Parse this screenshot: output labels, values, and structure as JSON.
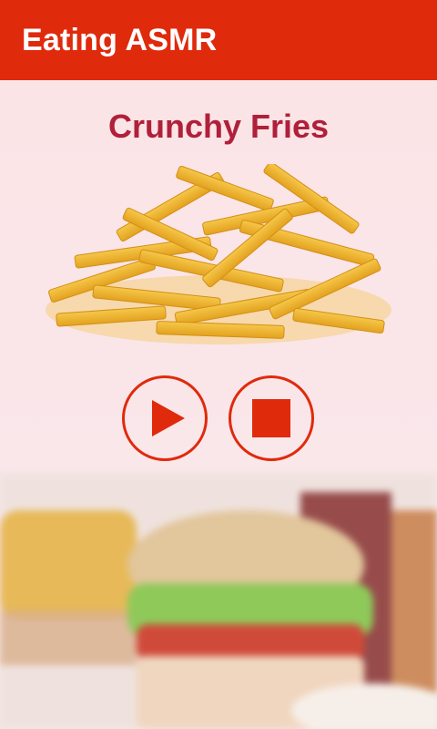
{
  "app": {
    "title": "Eating ASMR"
  },
  "main": {
    "title": "Crunchy Fries"
  },
  "controls": {
    "play_icon": "play-icon",
    "stop_icon": "stop-icon",
    "accent": "#e02a0c"
  },
  "colors": {
    "appbar": "#e02a0c",
    "background": "#fbe4e6",
    "title": "#b0203a"
  }
}
